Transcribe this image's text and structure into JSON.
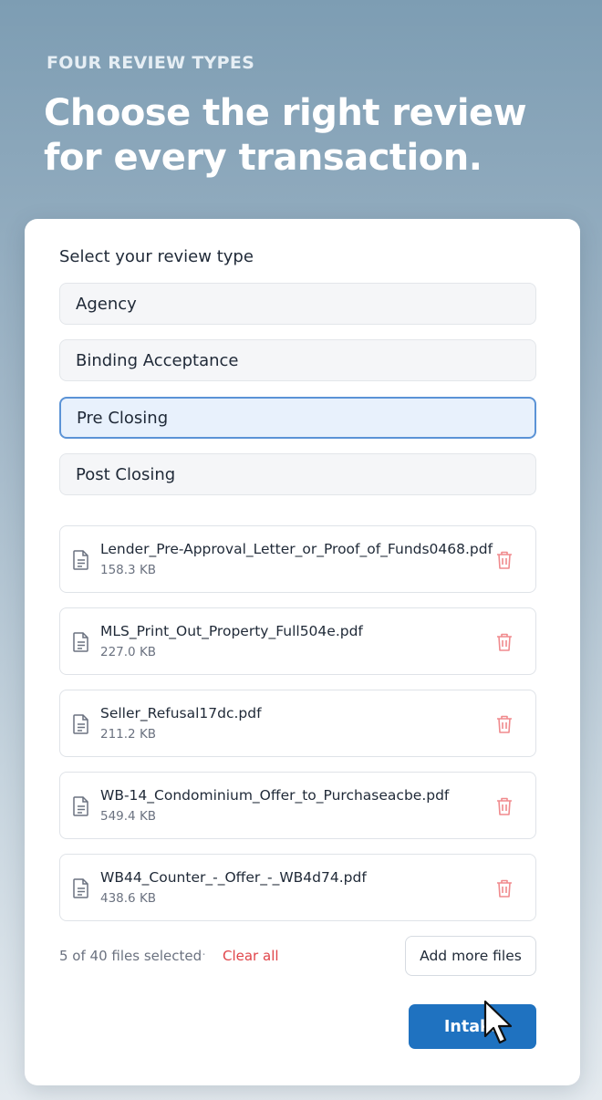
{
  "header": {
    "eyebrow": "FOUR REVIEW TYPES",
    "headline": "Choose the right review for every transaction."
  },
  "review": {
    "label": "Select your review type",
    "options": [
      {
        "label": "Agency",
        "selected": false
      },
      {
        "label": "Binding Acceptance",
        "selected": false
      },
      {
        "label": "Pre Closing",
        "selected": true
      },
      {
        "label": "Post Closing",
        "selected": false
      }
    ]
  },
  "files": [
    {
      "name": "Lender_Pre-Approval_Letter_or_Proof_of_Funds0468.pdf",
      "size": "158.3 KB"
    },
    {
      "name": "MLS_Print_Out_Property_Full504e.pdf",
      "size": "227.0 KB"
    },
    {
      "name": "Seller_Refusal17dc.pdf",
      "size": "211.2 KB"
    },
    {
      "name": "WB-14_Condominium_Offer_to_Purchaseacbe.pdf",
      "size": "549.4 KB"
    },
    {
      "name": "WB44_Counter_-_Offer_-_WB4d74.pdf",
      "size": "438.6 KB"
    }
  ],
  "footer": {
    "count_text": "5 of 40 files selected",
    "separator": "·",
    "clear_all": "Clear all",
    "add_more": "Add more files",
    "intake": "Intake"
  },
  "icons": {
    "file": "document-icon",
    "delete": "trash-icon",
    "pointer": "mouse-cursor-icon"
  },
  "colors": {
    "accent": "#1f72c0",
    "selected_bg": "#e8f1fc",
    "selected_border": "#5b93d6",
    "danger": "#e0454a"
  }
}
